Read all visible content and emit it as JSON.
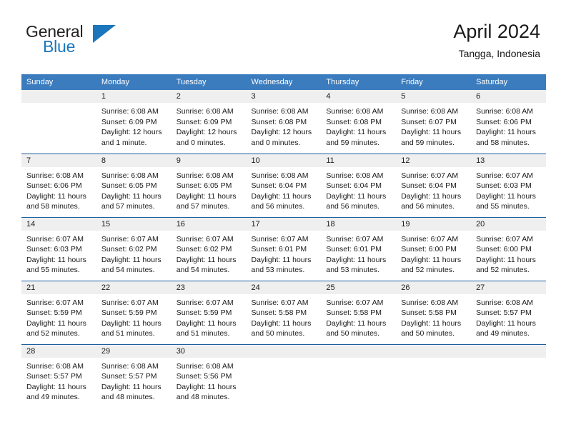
{
  "brand": {
    "name_top": "General",
    "name_bottom": "Blue",
    "triangle_color": "#1b76bc"
  },
  "header": {
    "title": "April 2024",
    "location": "Tangga, Indonesia"
  },
  "colors": {
    "header_bg": "#3a7cbe",
    "daynum_bg": "#efefef",
    "divider": "#1b5ea0"
  },
  "weekday_headers": [
    "Sunday",
    "Monday",
    "Tuesday",
    "Wednesday",
    "Thursday",
    "Friday",
    "Saturday"
  ],
  "weeks": [
    [
      {
        "day": "",
        "sunrise": "",
        "sunset": "",
        "daylight_a": "",
        "daylight_b": ""
      },
      {
        "day": "1",
        "sunrise": "Sunrise: 6:08 AM",
        "sunset": "Sunset: 6:09 PM",
        "daylight_a": "Daylight: 12 hours",
        "daylight_b": "and 1 minute."
      },
      {
        "day": "2",
        "sunrise": "Sunrise: 6:08 AM",
        "sunset": "Sunset: 6:09 PM",
        "daylight_a": "Daylight: 12 hours",
        "daylight_b": "and 0 minutes."
      },
      {
        "day": "3",
        "sunrise": "Sunrise: 6:08 AM",
        "sunset": "Sunset: 6:08 PM",
        "daylight_a": "Daylight: 12 hours",
        "daylight_b": "and 0 minutes."
      },
      {
        "day": "4",
        "sunrise": "Sunrise: 6:08 AM",
        "sunset": "Sunset: 6:08 PM",
        "daylight_a": "Daylight: 11 hours",
        "daylight_b": "and 59 minutes."
      },
      {
        "day": "5",
        "sunrise": "Sunrise: 6:08 AM",
        "sunset": "Sunset: 6:07 PM",
        "daylight_a": "Daylight: 11 hours",
        "daylight_b": "and 59 minutes."
      },
      {
        "day": "6",
        "sunrise": "Sunrise: 6:08 AM",
        "sunset": "Sunset: 6:06 PM",
        "daylight_a": "Daylight: 11 hours",
        "daylight_b": "and 58 minutes."
      }
    ],
    [
      {
        "day": "7",
        "sunrise": "Sunrise: 6:08 AM",
        "sunset": "Sunset: 6:06 PM",
        "daylight_a": "Daylight: 11 hours",
        "daylight_b": "and 58 minutes."
      },
      {
        "day": "8",
        "sunrise": "Sunrise: 6:08 AM",
        "sunset": "Sunset: 6:05 PM",
        "daylight_a": "Daylight: 11 hours",
        "daylight_b": "and 57 minutes."
      },
      {
        "day": "9",
        "sunrise": "Sunrise: 6:08 AM",
        "sunset": "Sunset: 6:05 PM",
        "daylight_a": "Daylight: 11 hours",
        "daylight_b": "and 57 minutes."
      },
      {
        "day": "10",
        "sunrise": "Sunrise: 6:08 AM",
        "sunset": "Sunset: 6:04 PM",
        "daylight_a": "Daylight: 11 hours",
        "daylight_b": "and 56 minutes."
      },
      {
        "day": "11",
        "sunrise": "Sunrise: 6:08 AM",
        "sunset": "Sunset: 6:04 PM",
        "daylight_a": "Daylight: 11 hours",
        "daylight_b": "and 56 minutes."
      },
      {
        "day": "12",
        "sunrise": "Sunrise: 6:07 AM",
        "sunset": "Sunset: 6:04 PM",
        "daylight_a": "Daylight: 11 hours",
        "daylight_b": "and 56 minutes."
      },
      {
        "day": "13",
        "sunrise": "Sunrise: 6:07 AM",
        "sunset": "Sunset: 6:03 PM",
        "daylight_a": "Daylight: 11 hours",
        "daylight_b": "and 55 minutes."
      }
    ],
    [
      {
        "day": "14",
        "sunrise": "Sunrise: 6:07 AM",
        "sunset": "Sunset: 6:03 PM",
        "daylight_a": "Daylight: 11 hours",
        "daylight_b": "and 55 minutes."
      },
      {
        "day": "15",
        "sunrise": "Sunrise: 6:07 AM",
        "sunset": "Sunset: 6:02 PM",
        "daylight_a": "Daylight: 11 hours",
        "daylight_b": "and 54 minutes."
      },
      {
        "day": "16",
        "sunrise": "Sunrise: 6:07 AM",
        "sunset": "Sunset: 6:02 PM",
        "daylight_a": "Daylight: 11 hours",
        "daylight_b": "and 54 minutes."
      },
      {
        "day": "17",
        "sunrise": "Sunrise: 6:07 AM",
        "sunset": "Sunset: 6:01 PM",
        "daylight_a": "Daylight: 11 hours",
        "daylight_b": "and 53 minutes."
      },
      {
        "day": "18",
        "sunrise": "Sunrise: 6:07 AM",
        "sunset": "Sunset: 6:01 PM",
        "daylight_a": "Daylight: 11 hours",
        "daylight_b": "and 53 minutes."
      },
      {
        "day": "19",
        "sunrise": "Sunrise: 6:07 AM",
        "sunset": "Sunset: 6:00 PM",
        "daylight_a": "Daylight: 11 hours",
        "daylight_b": "and 52 minutes."
      },
      {
        "day": "20",
        "sunrise": "Sunrise: 6:07 AM",
        "sunset": "Sunset: 6:00 PM",
        "daylight_a": "Daylight: 11 hours",
        "daylight_b": "and 52 minutes."
      }
    ],
    [
      {
        "day": "21",
        "sunrise": "Sunrise: 6:07 AM",
        "sunset": "Sunset: 5:59 PM",
        "daylight_a": "Daylight: 11 hours",
        "daylight_b": "and 52 minutes."
      },
      {
        "day": "22",
        "sunrise": "Sunrise: 6:07 AM",
        "sunset": "Sunset: 5:59 PM",
        "daylight_a": "Daylight: 11 hours",
        "daylight_b": "and 51 minutes."
      },
      {
        "day": "23",
        "sunrise": "Sunrise: 6:07 AM",
        "sunset": "Sunset: 5:59 PM",
        "daylight_a": "Daylight: 11 hours",
        "daylight_b": "and 51 minutes."
      },
      {
        "day": "24",
        "sunrise": "Sunrise: 6:07 AM",
        "sunset": "Sunset: 5:58 PM",
        "daylight_a": "Daylight: 11 hours",
        "daylight_b": "and 50 minutes."
      },
      {
        "day": "25",
        "sunrise": "Sunrise: 6:07 AM",
        "sunset": "Sunset: 5:58 PM",
        "daylight_a": "Daylight: 11 hours",
        "daylight_b": "and 50 minutes."
      },
      {
        "day": "26",
        "sunrise": "Sunrise: 6:08 AM",
        "sunset": "Sunset: 5:58 PM",
        "daylight_a": "Daylight: 11 hours",
        "daylight_b": "and 50 minutes."
      },
      {
        "day": "27",
        "sunrise": "Sunrise: 6:08 AM",
        "sunset": "Sunset: 5:57 PM",
        "daylight_a": "Daylight: 11 hours",
        "daylight_b": "and 49 minutes."
      }
    ],
    [
      {
        "day": "28",
        "sunrise": "Sunrise: 6:08 AM",
        "sunset": "Sunset: 5:57 PM",
        "daylight_a": "Daylight: 11 hours",
        "daylight_b": "and 49 minutes."
      },
      {
        "day": "29",
        "sunrise": "Sunrise: 6:08 AM",
        "sunset": "Sunset: 5:57 PM",
        "daylight_a": "Daylight: 11 hours",
        "daylight_b": "and 48 minutes."
      },
      {
        "day": "30",
        "sunrise": "Sunrise: 6:08 AM",
        "sunset": "Sunset: 5:56 PM",
        "daylight_a": "Daylight: 11 hours",
        "daylight_b": "and 48 minutes."
      },
      {
        "day": "",
        "sunrise": "",
        "sunset": "",
        "daylight_a": "",
        "daylight_b": ""
      },
      {
        "day": "",
        "sunrise": "",
        "sunset": "",
        "daylight_a": "",
        "daylight_b": ""
      },
      {
        "day": "",
        "sunrise": "",
        "sunset": "",
        "daylight_a": "",
        "daylight_b": ""
      },
      {
        "day": "",
        "sunrise": "",
        "sunset": "",
        "daylight_a": "",
        "daylight_b": ""
      }
    ]
  ]
}
